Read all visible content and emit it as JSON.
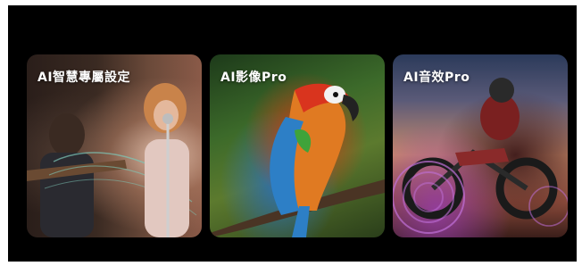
{
  "cards": [
    {
      "label": "AI智慧專屬設定",
      "image": "guitarist-and-singer-photo"
    },
    {
      "label": "AI影像Pro",
      "image": "parrot-photo"
    },
    {
      "label": "AI音效Pro",
      "image": "motocross-rider-photo"
    }
  ]
}
